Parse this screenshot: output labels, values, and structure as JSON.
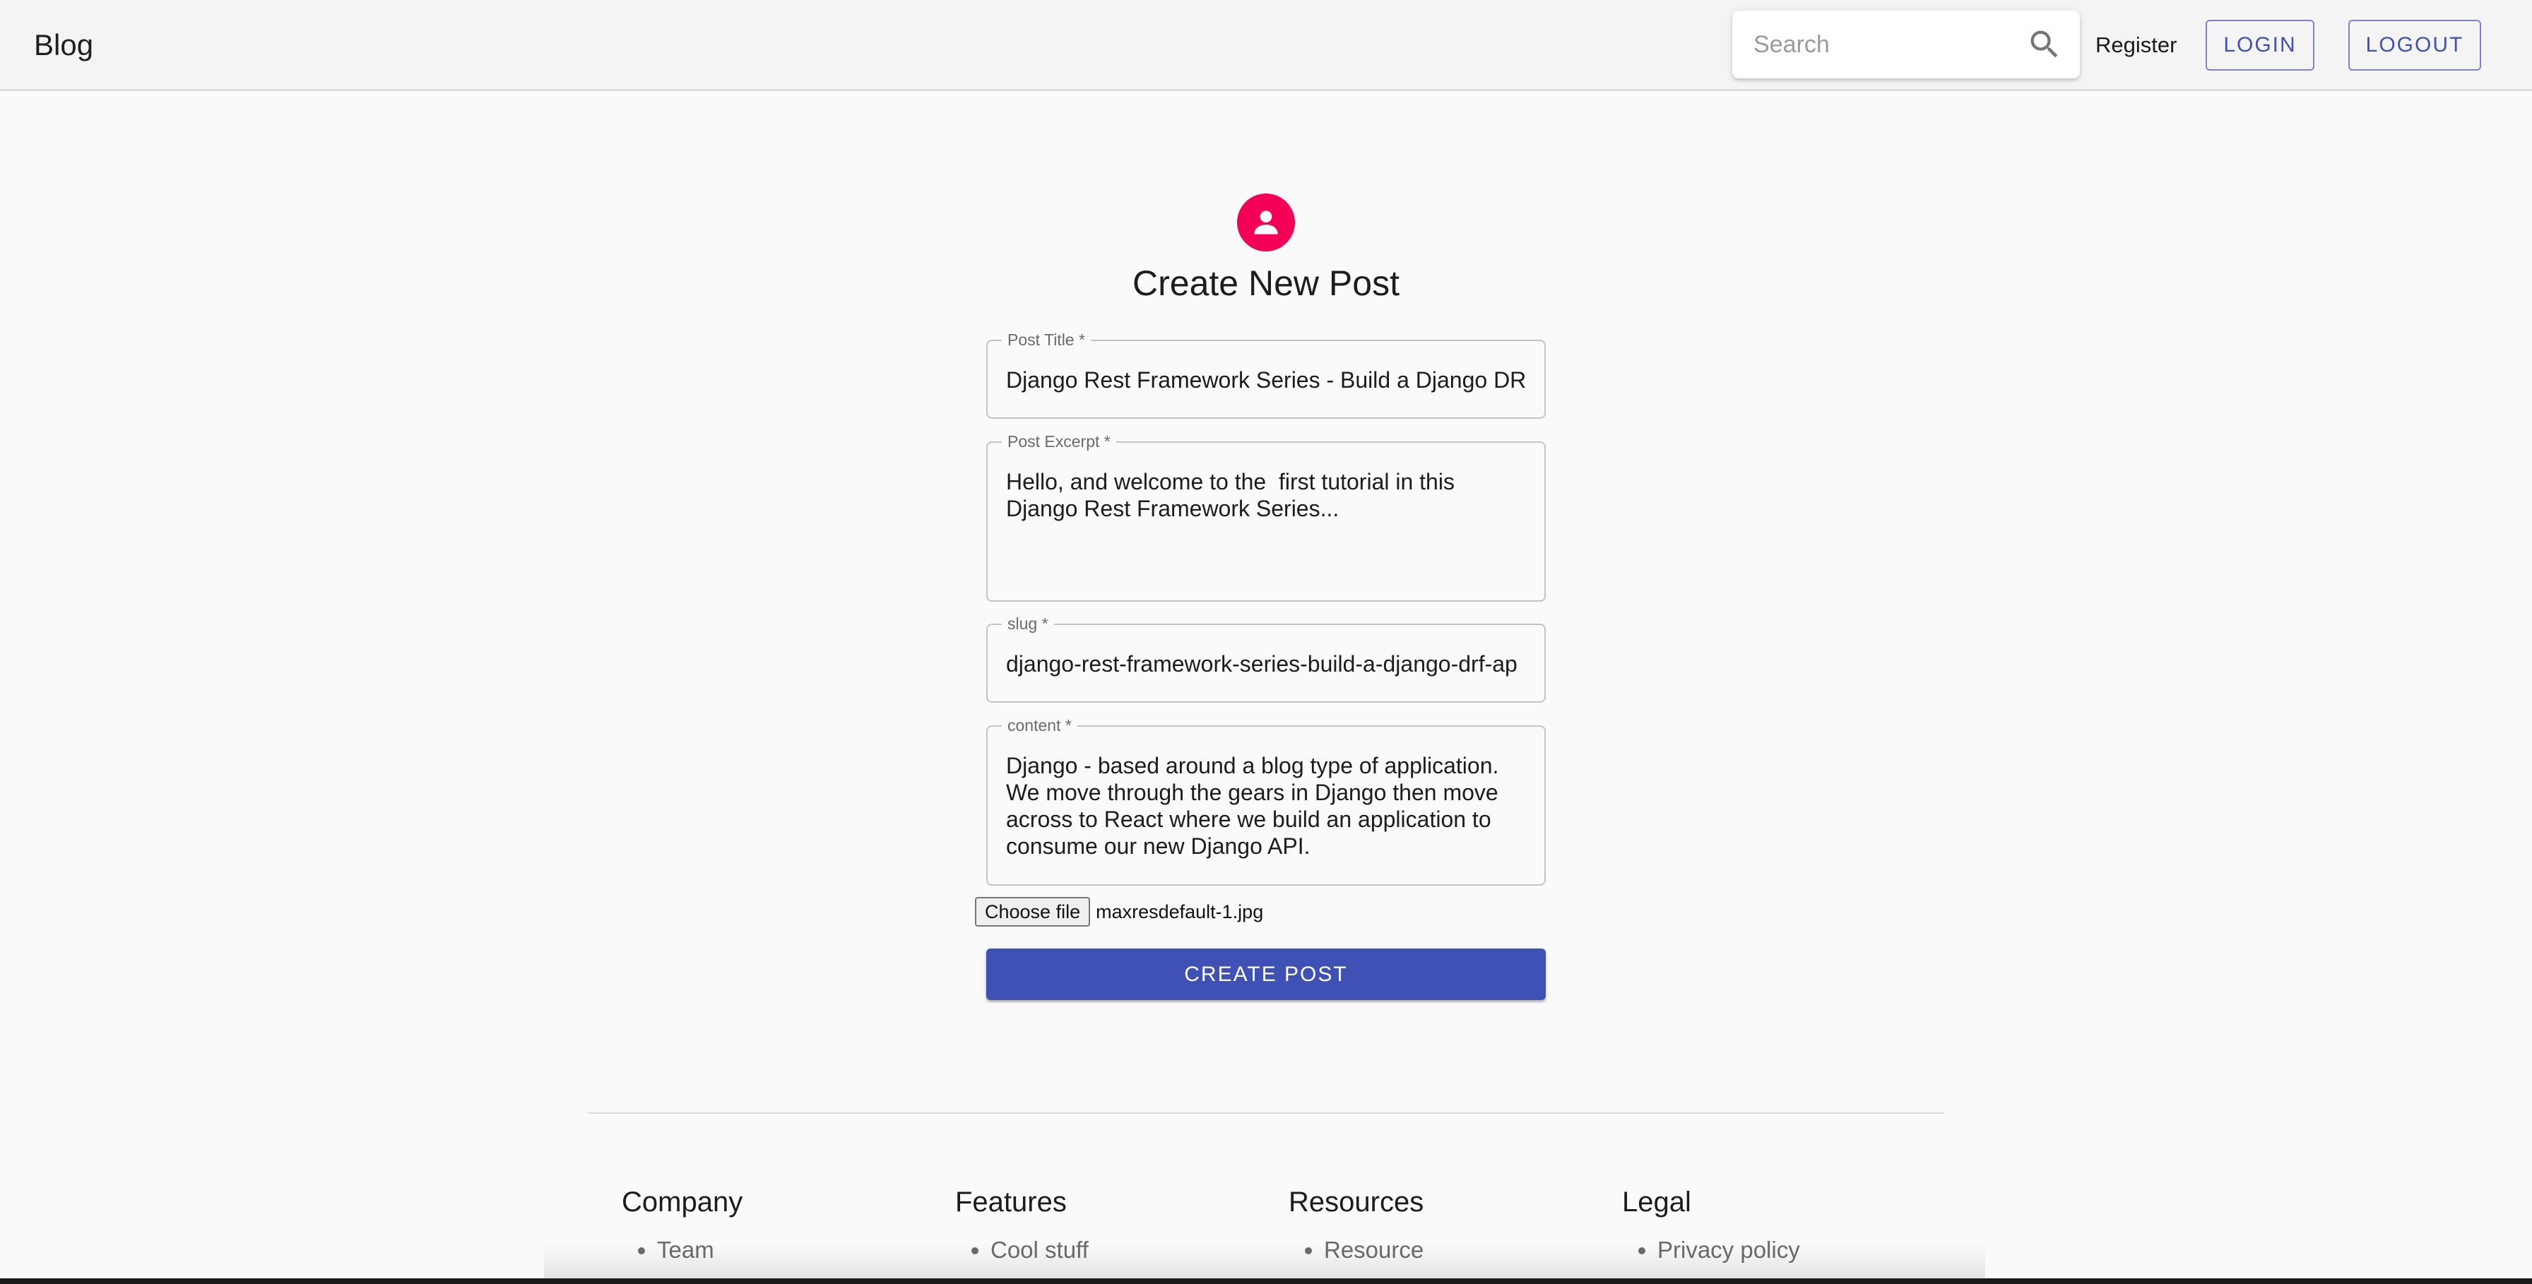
{
  "header": {
    "brand": "Blog",
    "search_placeholder": "Search",
    "register_label": "Register",
    "login_label": "LOGIN",
    "logout_label": "LOGOUT"
  },
  "form": {
    "avatar_icon": "person-icon",
    "avatar_color": "#f50057",
    "title": "Create New Post",
    "fields": {
      "post_title": {
        "label": "Post Title *",
        "value": "Django Rest Framework Series - Build a Django DRF"
      },
      "post_excerpt": {
        "label": "Post Excerpt *",
        "value": "Hello, and welcome to the  first tutorial in this\nDjango Rest Framework Series..."
      },
      "slug": {
        "label": "slug *",
        "value": "django-rest-framework-series-build-a-django-drf-ap"
      },
      "content": {
        "label": "content *",
        "value": "Django - based around a blog type of application.\nWe move through the gears in Django then move\nacross to React where we build an application to\nconsume our new Django API."
      }
    },
    "file": {
      "button_label": "Choose file",
      "file_name": "maxresdefault-1.jpg"
    },
    "submit_label": "CREATE POST",
    "primary_color": "#3f51b5"
  },
  "footer": {
    "columns": [
      {
        "heading": "Company",
        "items": [
          "Team"
        ]
      },
      {
        "heading": "Features",
        "items": [
          "Cool stuff"
        ]
      },
      {
        "heading": "Resources",
        "items": [
          "Resource"
        ]
      },
      {
        "heading": "Legal",
        "items": [
          "Privacy policy"
        ]
      }
    ]
  }
}
